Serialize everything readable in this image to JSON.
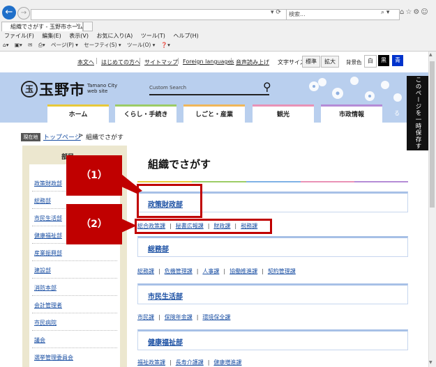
{
  "browser": {
    "address": "",
    "search_placeholder": "検索...",
    "tab_title": "組織でさがす - 玉野市ホームペ...",
    "menu": [
      "ファイル(F)",
      "編集(E)",
      "表示(V)",
      "お気に入り(A)",
      "ツール(T)",
      "ヘルプ(H)"
    ],
    "cmd": [
      "ページ(P) ▾",
      "セーフティ(S) ▾",
      "ツール(O) ▾"
    ]
  },
  "utility": {
    "links": [
      "本文へ",
      "はじめての方へ",
      "サイトマップ",
      "Foreign languages",
      "音声読み上げ"
    ],
    "fontsize_label": "文字サイズ",
    "fontsize_standard": "標準",
    "fontsize_large": "拡大",
    "bg_label": "背景色",
    "bg_white": "白",
    "bg_black": "黒",
    "bg_blue": "青"
  },
  "header": {
    "logo_mark": "玉",
    "logo_text": "玉野市",
    "logo_en_1": "Tamano City",
    "logo_en_2": "web site",
    "search_placeholder": "Custom Search",
    "save_tab": "このページを一時保存する"
  },
  "gnav": [
    "ホーム",
    "くらし・手続き",
    "しごと・産業",
    "観光",
    "市政情報"
  ],
  "breadcrumb": {
    "current_label": "現在地",
    "top": "トップページ",
    "sep": ">",
    "here": "組織でさがす"
  },
  "sidebar": {
    "title": "部局",
    "items": [
      "政策財政部",
      "総務部",
      "市民生活部",
      "健康福祉部",
      "産業振興部",
      "建設部",
      "消防本部",
      "会計管理者",
      "市民病院",
      "議会",
      "選挙管理委員会"
    ]
  },
  "main": {
    "title": "組織でさがす",
    "departments": [
      {
        "name": "政策財政部",
        "sections": [
          "総合政策課",
          "秘書広報課",
          "財政課",
          "税務課"
        ]
      },
      {
        "name": "総務部",
        "sections": [
          "総務課",
          "危機管理課",
          "人事課",
          "協働推進課",
          "契約管理課"
        ]
      },
      {
        "name": "市民生活部",
        "sections": [
          "市民課",
          "保険年金課",
          "環境保全課"
        ]
      },
      {
        "name": "健康福祉部",
        "sections": [
          "福祉政策課",
          "長寿介護課",
          "健康増進課"
        ]
      }
    ]
  },
  "annotations": {
    "label1": "（1）",
    "label2": "（2）"
  },
  "colors": {
    "accent": "#c00000",
    "link": "#1a4fa3",
    "header": "#b9cfee"
  }
}
